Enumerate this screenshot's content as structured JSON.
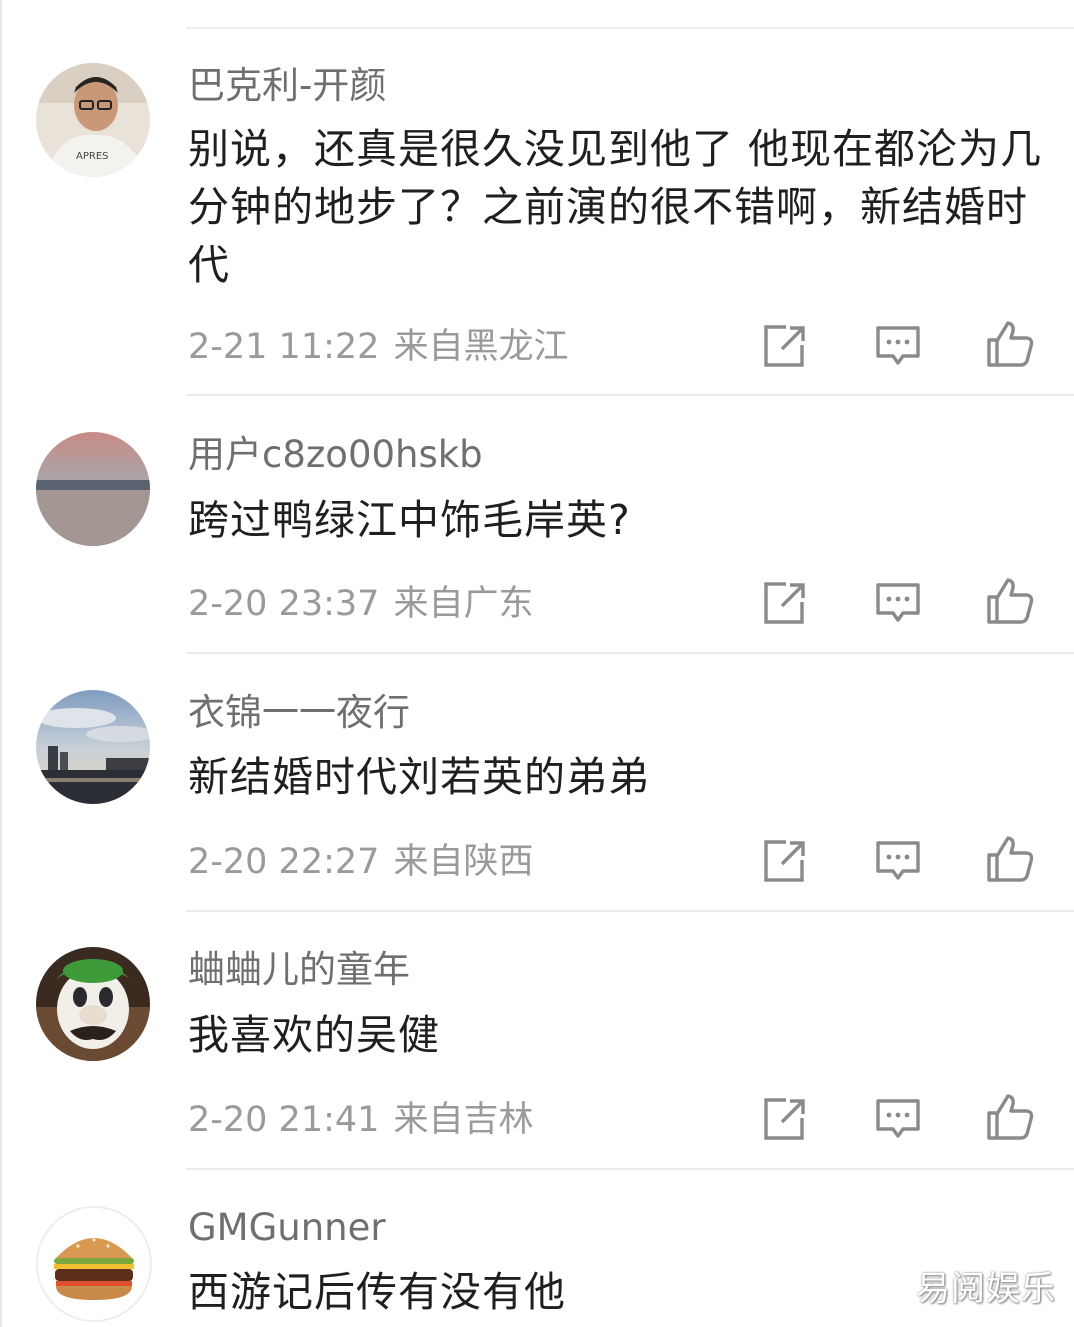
{
  "comments": [
    {
      "username": "巴克利-开颜",
      "content": "别说，还真是很久没见到他了 他现在都沦为几分钟的地步了？之前演的很不错啊，新结婚时代",
      "date": "2-21 11:22",
      "location": "来自黑龙江",
      "avatar_icon": "man-with-glasses-avatar"
    },
    {
      "username": "用户c8zo00hskb",
      "content": "跨过鸭绿江中饰毛岸英?",
      "date": "2-20 23:37",
      "location": "来自广东",
      "avatar_icon": "river-sunset-avatar"
    },
    {
      "username": "衣锦一一夜行",
      "content": "新结婚时代刘若英的弟弟",
      "date": "2-20 22:27",
      "location": "来自陕西",
      "avatar_icon": "city-skyline-avatar"
    },
    {
      "username": "蛐蛐儿的童年",
      "content": "我喜欢的吴健",
      "date": "2-20 21:41",
      "location": "来自吉林",
      "avatar_icon": "mascot-avatar"
    },
    {
      "username": "GMGunner",
      "content": "西游记后传有没有他",
      "date": "",
      "location": "",
      "avatar_icon": "burger-avatar"
    }
  ],
  "actions": {
    "share_icon": "share-icon",
    "reply_icon": "comment-icon",
    "like_icon": "thumbs-up-icon"
  },
  "watermark": "易阅娱乐",
  "colors": {
    "username": "#6f6f6f",
    "content": "#1f1f1f",
    "meta": "#9a9a9a",
    "icon": "#8a8a8a",
    "divider": "#ececec"
  }
}
